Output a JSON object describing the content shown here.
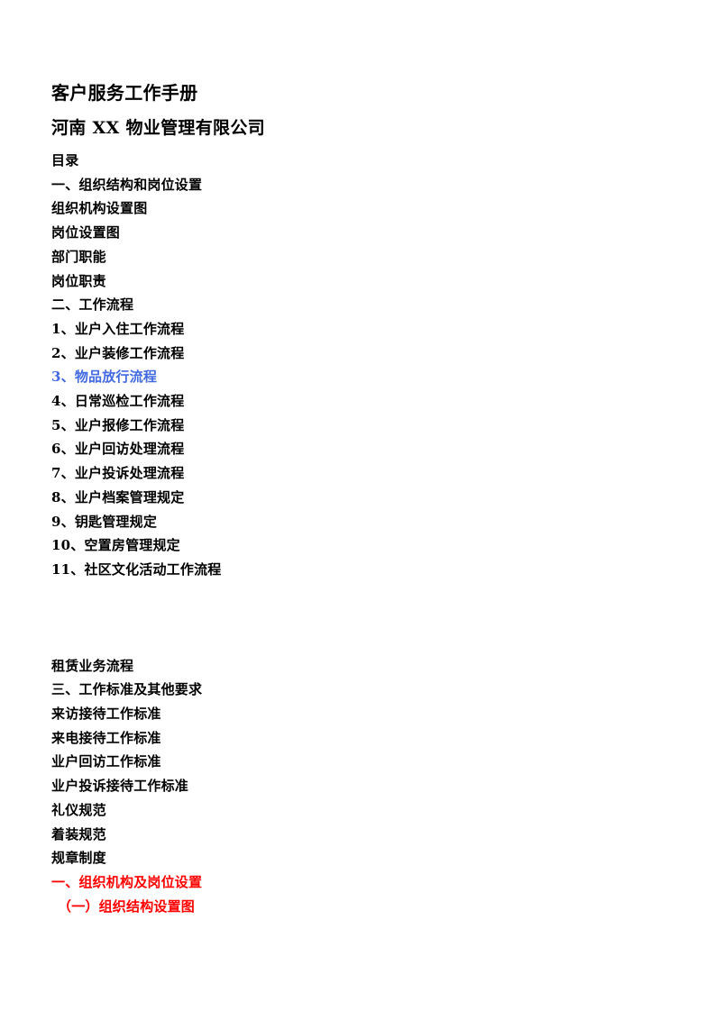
{
  "document": {
    "title": "客户服务工作手册",
    "company": "河南 XX 物业管理有限公司",
    "toc_heading": "目录"
  },
  "colors": {
    "text": "#000000",
    "link_blue": "#4169e1",
    "highlight_red": "#ff0000",
    "page_background": "#ffffff"
  },
  "toc": {
    "block_one": [
      {
        "text": "一、组织结构和岗位设置",
        "style": "normal"
      },
      {
        "text": "组织机构设置图",
        "style": "normal"
      },
      {
        "text": "岗位设置图",
        "style": "normal"
      },
      {
        "text": "部门职能",
        "style": "normal"
      },
      {
        "text": "岗位职责",
        "style": "normal"
      },
      {
        "text": "二、工作流程",
        "style": "normal"
      },
      {
        "text": "1、业户入住工作流程",
        "style": "normal"
      },
      {
        "text": "2、业户装修工作流程",
        "style": "normal"
      },
      {
        "text": "3、物品放行流程",
        "style": "link"
      },
      {
        "text": "4、日常巡检工作流程",
        "style": "normal"
      },
      {
        "text": "5、业户报修工作流程",
        "style": "normal"
      },
      {
        "text": "6、业户回访处理流程",
        "style": "normal"
      },
      {
        "text": "7、业户投诉处理流程",
        "style": "normal"
      },
      {
        "text": "8、业户档案管理规定",
        "style": "normal"
      },
      {
        "text": "9、钥匙管理规定",
        "style": "normal"
      },
      {
        "text": "10、空置房管理规定",
        "style": "normal"
      },
      {
        "text": "11、社区文化活动工作流程",
        "style": "normal"
      }
    ],
    "block_two": [
      {
        "text": "租赁业务流程",
        "style": "normal"
      },
      {
        "text": "三、工作标准及其他要求",
        "style": "normal"
      },
      {
        "text": "来访接待工作标准",
        "style": "normal"
      },
      {
        "text": "来电接待工作标准",
        "style": "normal"
      },
      {
        "text": "业户回访工作标准",
        "style": "normal"
      },
      {
        "text": "业户投诉接待工作标准",
        "style": "normal"
      },
      {
        "text": "礼仪规范",
        "style": "normal"
      },
      {
        "text": "着装规范",
        "style": "normal"
      },
      {
        "text": "规章制度",
        "style": "normal"
      },
      {
        "text": "一、组织机构及岗位设置",
        "style": "red"
      },
      {
        "text": "（一）组织结构设置图",
        "style": "red indent"
      }
    ]
  }
}
